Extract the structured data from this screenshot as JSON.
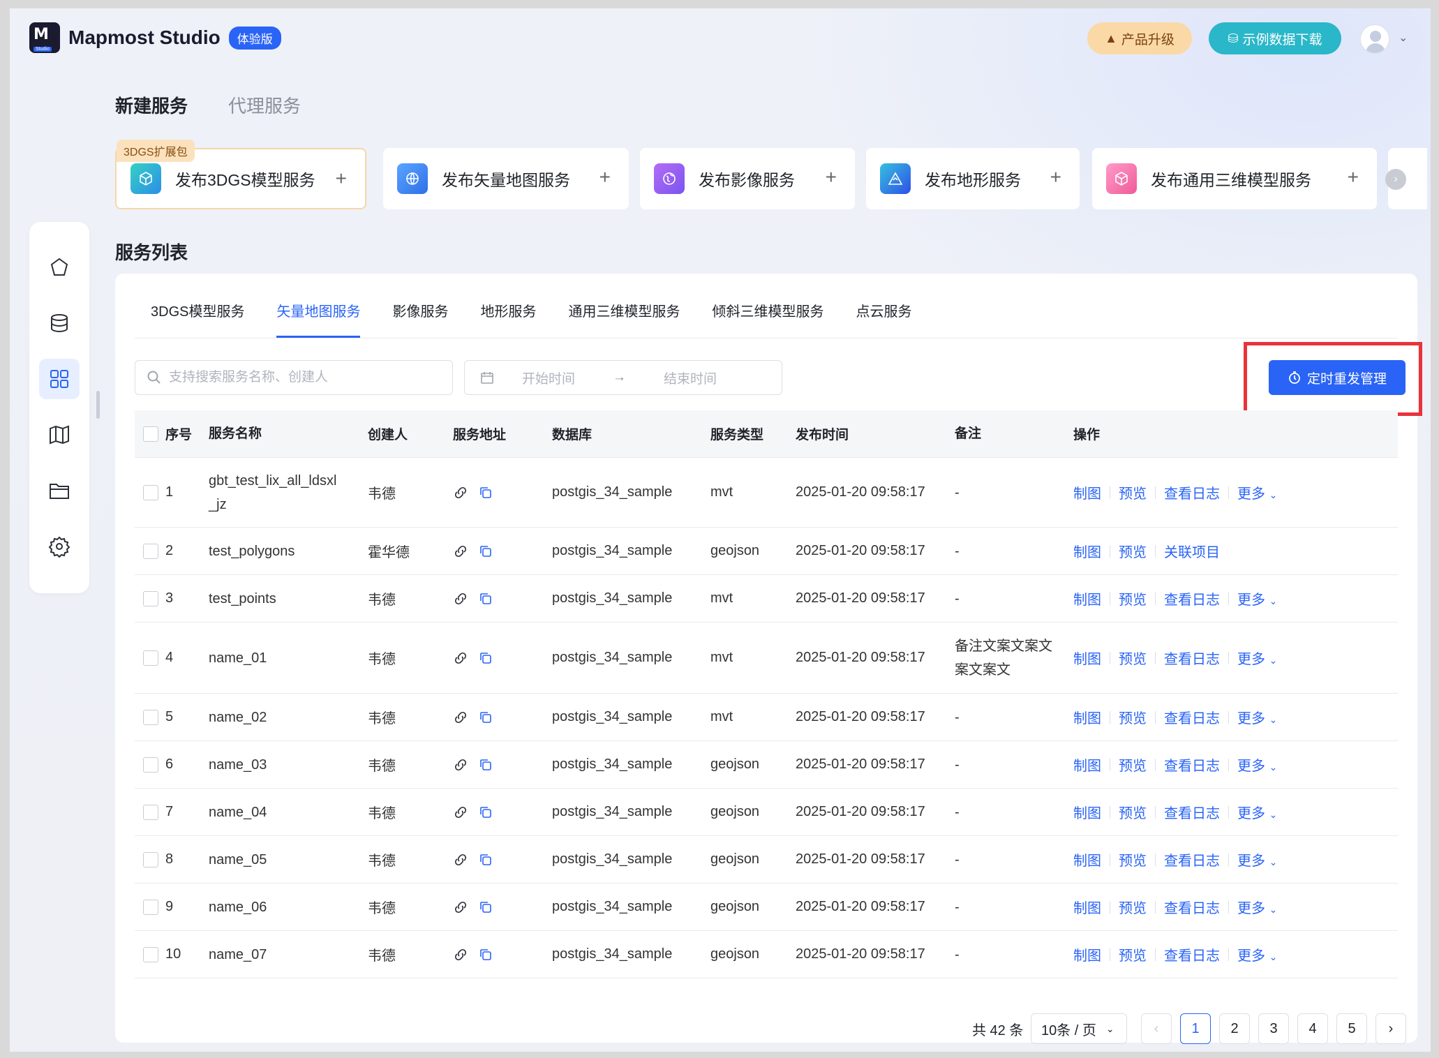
{
  "header": {
    "brand": "Mapmost Studio",
    "logo_sub": "Studio",
    "trial_badge": "体验版",
    "upgrade_label": "产品升级",
    "download_label": "示例数据下载"
  },
  "top_tabs": [
    "新建服务",
    "代理服务"
  ],
  "cards": [
    {
      "ribbon": "3DGS扩展包",
      "label": "发布3DGS模型服务",
      "color": "#2bb5c7"
    },
    {
      "label": "发布矢量地图服务",
      "color": "#3b7df2"
    },
    {
      "label": "发布影像服务",
      "color": "#8b5cf6"
    },
    {
      "label": "发布地形服务",
      "color": "#2f6fe8"
    },
    {
      "label": "发布通用三维模型服务",
      "color": "#f06bb0"
    }
  ],
  "section_title": "服务列表",
  "service_tabs": [
    "3DGS模型服务",
    "矢量地图服务",
    "影像服务",
    "地形服务",
    "通用三维模型服务",
    "倾斜三维模型服务",
    "点云服务"
  ],
  "active_service_tab": "矢量地图服务",
  "search": {
    "placeholder": "支持搜索服务名称、创建人"
  },
  "date_range": {
    "start_placeholder": "开始时间",
    "arrow": "→",
    "end_placeholder": "结束时间"
  },
  "schedule_button": "定时重发管理",
  "table": {
    "headers": {
      "idx": "序号",
      "name": "服务名称",
      "creator": "创建人",
      "addr": "服务地址",
      "db": "数据库",
      "type": "服务类型",
      "time": "发布时间",
      "note": "备注",
      "ops": "操作"
    },
    "rows": [
      {
        "idx": "1",
        "name": "gbt_test_lix_all_ldsxl_jz",
        "creator": "韦德",
        "db": "postgis_34_sample",
        "type": "mvt",
        "time": "2025-01-20 09:58:17",
        "note": "-",
        "ops": [
          "制图",
          "预览",
          "查看日志"
        ],
        "more": "更多"
      },
      {
        "idx": "2",
        "name": "test_polygons",
        "creator": "霍华德",
        "db": "postgis_34_sample",
        "type": "geojson",
        "time": "2025-01-20 09:58:17",
        "note": "-",
        "ops": [
          "制图",
          "预览",
          "关联项目"
        ],
        "more": ""
      },
      {
        "idx": "3",
        "name": "test_points",
        "creator": "韦德",
        "db": "postgis_34_sample",
        "type": "mvt",
        "time": "2025-01-20 09:58:17",
        "note": "-",
        "ops": [
          "制图",
          "预览",
          "查看日志"
        ],
        "more": "更多"
      },
      {
        "idx": "4",
        "name": "name_01",
        "creator": "韦德",
        "db": "postgis_34_sample",
        "type": "mvt",
        "time": "2025-01-20 09:58:17",
        "note": "备注文案文案文案文案文",
        "ops": [
          "制图",
          "预览",
          "查看日志"
        ],
        "more": "更多"
      },
      {
        "idx": "5",
        "name": "name_02",
        "creator": "韦德",
        "db": "postgis_34_sample",
        "type": "mvt",
        "time": "2025-01-20 09:58:17",
        "note": "-",
        "ops": [
          "制图",
          "预览",
          "查看日志"
        ],
        "more": "更多"
      },
      {
        "idx": "6",
        "name": "name_03",
        "creator": "韦德",
        "db": "postgis_34_sample",
        "type": "geojson",
        "time": "2025-01-20 09:58:17",
        "note": "-",
        "ops": [
          "制图",
          "预览",
          "查看日志"
        ],
        "more": "更多"
      },
      {
        "idx": "7",
        "name": "name_04",
        "creator": "韦德",
        "db": "postgis_34_sample",
        "type": "geojson",
        "time": "2025-01-20 09:58:17",
        "note": "-",
        "ops": [
          "制图",
          "预览",
          "查看日志"
        ],
        "more": "更多"
      },
      {
        "idx": "8",
        "name": "name_05",
        "creator": "韦德",
        "db": "postgis_34_sample",
        "type": "geojson",
        "time": "2025-01-20 09:58:17",
        "note": "-",
        "ops": [
          "制图",
          "预览",
          "查看日志"
        ],
        "more": "更多"
      },
      {
        "idx": "9",
        "name": "name_06",
        "creator": "韦德",
        "db": "postgis_34_sample",
        "type": "geojson",
        "time": "2025-01-20 09:58:17",
        "note": "-",
        "ops": [
          "制图",
          "预览",
          "查看日志"
        ],
        "more": "更多"
      },
      {
        "idx": "10",
        "name": "name_07",
        "creator": "韦德",
        "db": "postgis_34_sample",
        "type": "geojson",
        "time": "2025-01-20 09:58:17",
        "note": "-",
        "ops": [
          "制图",
          "预览",
          "查看日志"
        ],
        "more": "更多"
      }
    ]
  },
  "pagination": {
    "total": "共 42 条",
    "page_size": "10条 / 页",
    "pages": [
      "1",
      "2",
      "3",
      "4",
      "5"
    ],
    "current": "1"
  },
  "sidebar": [
    "home-icon",
    "database-icon",
    "grid-apps-icon",
    "map-icon",
    "folder-icon",
    "settings-icon"
  ]
}
